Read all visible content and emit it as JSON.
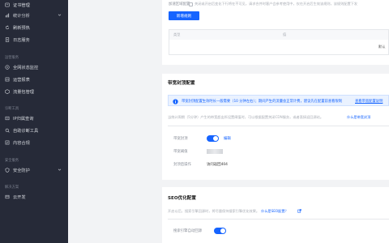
{
  "sidebar": {
    "items": [
      {
        "label": "证书管理",
        "icon": "certificate-icon"
      },
      {
        "label": "统计分析",
        "icon": "chart-icon",
        "has_arrow": true
      },
      {
        "label": "刷新预热",
        "icon": "refresh-icon"
      },
      {
        "label": "日志服务",
        "icon": "log-icon"
      }
    ],
    "group_ops": "运营服务",
    "ops_items": [
      {
        "label": "全网状态监控",
        "icon": "monitor-icon"
      },
      {
        "label": "运营报表",
        "icon": "report-icon"
      },
      {
        "label": "流量包管理",
        "icon": "package-icon"
      }
    ],
    "group_diag": "诊断工具",
    "diag_items": [
      {
        "label": "IP归属查询",
        "icon": "ip-search-icon"
      },
      {
        "label": "自助诊断工具",
        "icon": "diagnose-icon"
      },
      {
        "label": "内容合规",
        "icon": "compliance-icon"
      }
    ],
    "group_security": "安全服务",
    "security_items": [
      {
        "label": "安全防护",
        "icon": "shield-icon",
        "has_arrow": true
      }
    ],
    "group_solution": "解决方案",
    "solution_items": [
      {
        "label": "云开发",
        "icon": "cloud-icon"
      }
    ]
  },
  "top_card": {
    "row_label": "加速区域配置",
    "row_desc": "关闭或开启后变化下行将在不可见，请求合并时客户会参考使用中，仅在开启后生效该规则，该规则配置下发",
    "add_button": "新增规则",
    "table_headers": [
      "类型",
      "值"
    ],
    "row_value": "默认"
  },
  "bandwidth_card": {
    "title": "带宽封顶配置",
    "info_text": "带宽封顶配置生效时长一般需要（10 分钟左右）；期间产生的流量会正常计费，建议先在配置前查看限制",
    "info_link": "查看带宽配置说明",
    "desc": "当统计周期（5分钟）产生的带宽超出所设置阈值时，可以根据配置关闭CDN服务，或者直接返回源站。",
    "desc_link": "什么是带宽封顶",
    "fields": [
      {
        "label": "带宽封顶"
      },
      {
        "label": "带宽阈值"
      },
      {
        "label": "封顶后操作",
        "value": "访问返回404"
      }
    ],
    "edit_label": "编辑",
    "toggle_on": true
  },
  "seo_card": {
    "title": "SEO优化配置",
    "desc": "开启以后，搜索引擎回源时，将尽量保持搜索引擎优化效果。",
    "desc_link": "什么是SEO配置？",
    "field_label": "搜索引擎自动回源",
    "toggle_on": true
  }
}
